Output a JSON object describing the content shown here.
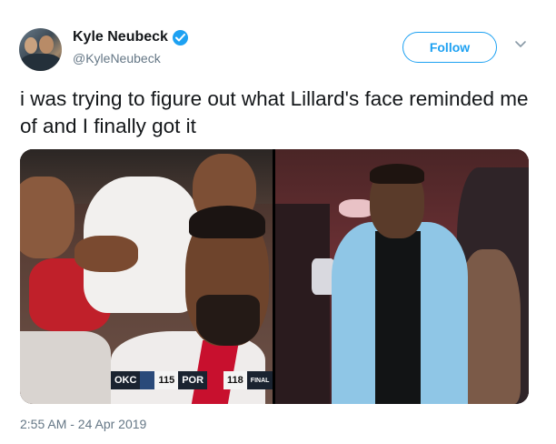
{
  "user": {
    "display_name": "Kyle Neubeck",
    "handle": "@KyleNeubeck",
    "verified": true
  },
  "actions": {
    "follow_label": "Follow"
  },
  "tweet": {
    "text": "i was trying to figure out what Lillard's face reminded me of and I finally got it",
    "timestamp": "2:55 AM - 24 Apr 2019"
  },
  "scoreboard": {
    "away_team": "OKC",
    "away_score": "115",
    "home_team": "POR",
    "home_score": "118",
    "status": "FINAL"
  },
  "colors": {
    "accent": "#1da1f2",
    "text": "#14171a",
    "secondary": "#657786"
  }
}
